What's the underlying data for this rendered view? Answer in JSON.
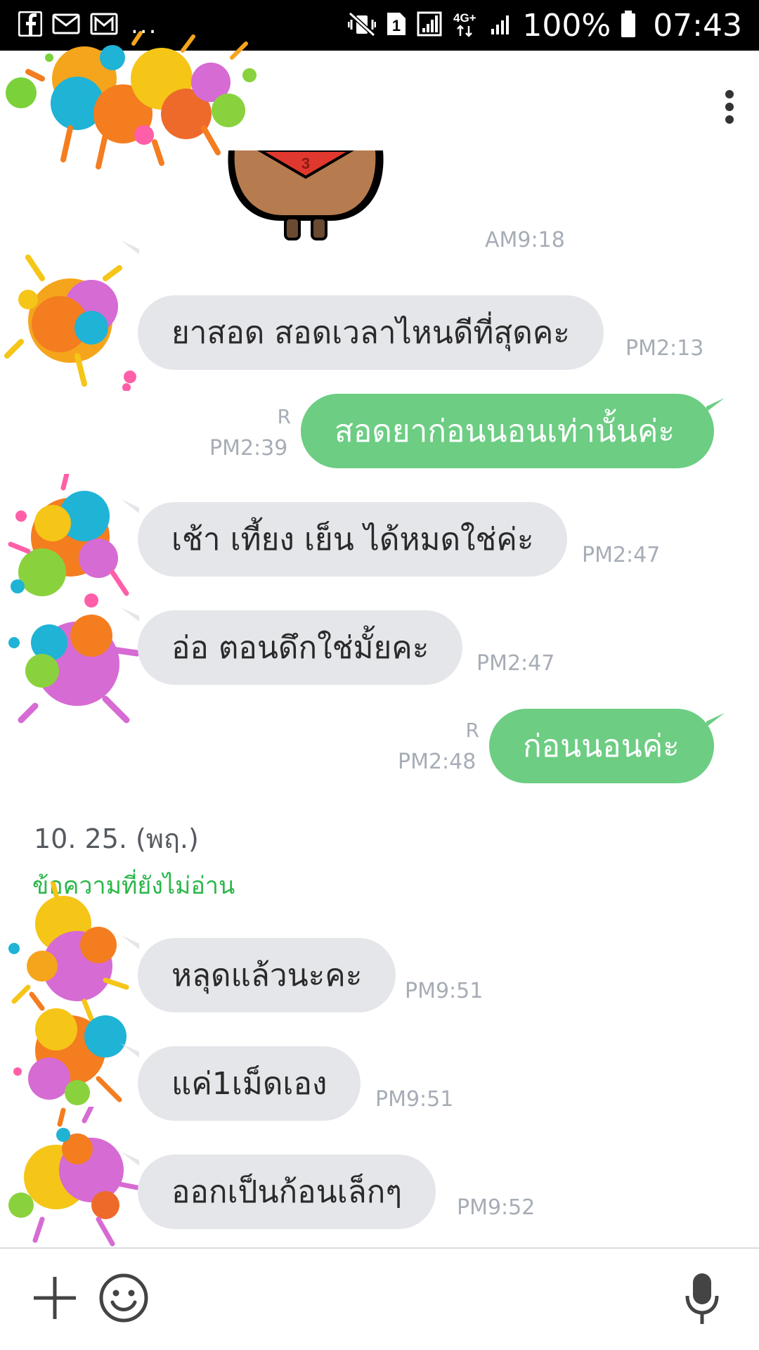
{
  "status_bar": {
    "icons_left": [
      "facebook-icon",
      "mail-icon",
      "gmail-icon"
    ],
    "overflow": "...",
    "icons_right": [
      "vibrate-mute-icon",
      "sim-1-icon",
      "signal-icon",
      "network-4g-icon",
      "signal-icon",
      "battery-icon"
    ],
    "network_label": "4G+",
    "sim_label": "1",
    "battery": "100%",
    "time": "07:43"
  },
  "header": {
    "menu_icon": "more-vertical-icon"
  },
  "chat": {
    "sticker_time": "AM9:18",
    "messages": [
      {
        "dir": "in",
        "text": "ยาสอด สอดเวลาไหนดีที่สุดคะ",
        "time": "PM2:13"
      },
      {
        "dir": "out",
        "text": "สอดยาก่อนนอนเท่านั้นค่ะ",
        "time": "PM2:39",
        "read": "R"
      },
      {
        "dir": "in",
        "text": "เช้า เที้ยง เย็น ได้หมดใช่ค่ะ",
        "time": "PM2:47"
      },
      {
        "dir": "in",
        "text": "อ่อ ตอนดึกใช่มั้ยคะ",
        "time": "PM2:47"
      },
      {
        "dir": "out",
        "text": "ก่อนนอนค่ะ",
        "time": "PM2:48",
        "read": "R"
      }
    ],
    "date_separator": "10. 25. (พฤ.)",
    "unread_label": "ข้อความที่ยังไม่อ่าน",
    "messages_after": [
      {
        "dir": "in",
        "text": "หลุดแล้วนะคะ",
        "time": "PM9:51"
      },
      {
        "dir": "in",
        "text": "แค่1เม็ดเอง",
        "time": "PM9:51"
      },
      {
        "dir": "in",
        "text": "ออกเป็นก้อนเล็กๆ",
        "time": "PM9:52"
      }
    ]
  },
  "input_bar": {
    "icons": [
      "plus-icon",
      "emoji-icon",
      "microphone-icon"
    ]
  },
  "colors": {
    "incoming_bubble": "#e5e6ea",
    "outgoing_bubble": "#6ccd83",
    "timestamp": "#a7adb6",
    "unread_label": "#2bb74a"
  }
}
